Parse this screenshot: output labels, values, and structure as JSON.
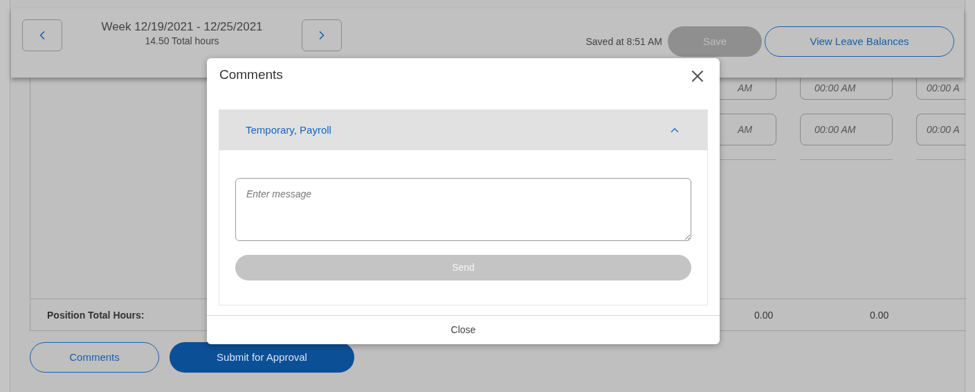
{
  "header": {
    "week": "Week 12/19/2021 - 12/25/2021",
    "total_hours": "14.50 Total hours",
    "saved_status": "Saved at 8:51 AM",
    "save_button": {
      "label": "Save",
      "disabled": true
    },
    "leave_balances_button": "View Leave Balances"
  },
  "time_grid": {
    "rows": [
      [
        "AM",
        "00:00 AM",
        "00:00 A"
      ],
      [
        "AM",
        "00:00 AM",
        "00:00 A"
      ]
    ]
  },
  "position_total": {
    "label": "Position Total Hours:",
    "values": [
      "0.00",
      "0.00"
    ]
  },
  "actions": {
    "comments_button": "Comments",
    "submit_button": "Submit for Approval"
  },
  "modal": {
    "title": "Comments",
    "thread": {
      "name": "Temporary, Payroll",
      "expanded": true,
      "message": {
        "placeholder": "Enter message"
      },
      "send_button": {
        "label": "Send",
        "disabled": true
      }
    },
    "close_button": "Close"
  }
}
